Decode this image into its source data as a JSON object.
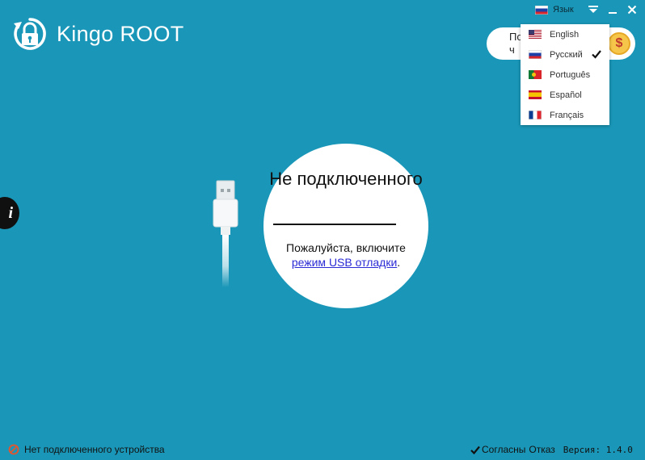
{
  "app": {
    "title": "Kingo ROOT",
    "logo_icon": "lock-refresh-icon"
  },
  "window": {
    "language_label": "Язык",
    "controls": [
      "menu-icon",
      "minimize-icon",
      "close-icon"
    ]
  },
  "top_pill": {
    "text_line1": "По",
    "text_line2": "ч",
    "coin_symbol": "$"
  },
  "language_menu": {
    "items": [
      {
        "label": "English",
        "flag": "us-flag-icon",
        "selected": false
      },
      {
        "label": "Русский",
        "flag": "ru-flag-icon",
        "selected": true
      },
      {
        "label": "Português",
        "flag": "pt-flag-icon",
        "selected": false
      },
      {
        "label": "Español",
        "flag": "es-flag-icon",
        "selected": false
      },
      {
        "label": "Français",
        "flag": "fr-flag-icon",
        "selected": false
      }
    ]
  },
  "side": {
    "info_symbol": "i"
  },
  "status_circle": {
    "title": "Не подключенного",
    "desc_prefix": "Пожалуйста, включите",
    "desc_link": "режим USB отладки",
    "desc_suffix": "."
  },
  "statusbar": {
    "connection_text": "Нет подключенного устройства",
    "agree_label": "Согласны",
    "reject_label": "Отказ",
    "version_text": "Версия: 1.4.0"
  },
  "colors": {
    "background": "#1a97b8",
    "link": "#2b2bd6",
    "coin": "#f6c64a",
    "status_icon": "#e8532b"
  }
}
